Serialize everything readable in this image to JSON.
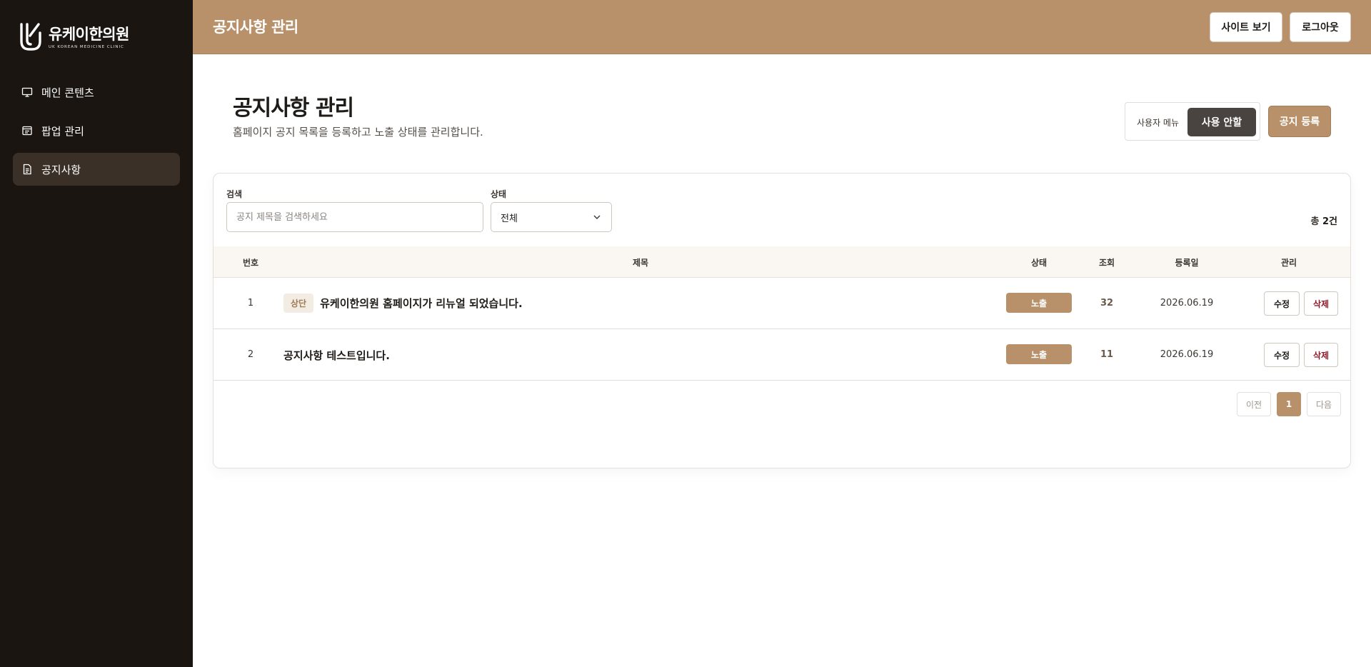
{
  "brand": {
    "name": "유케이한의원",
    "subtitle": "UK KOREAN MEDICINE CLINIC"
  },
  "sidebar": {
    "items": [
      {
        "label": "메인 콘텐츠",
        "icon": "monitor-icon",
        "active": false
      },
      {
        "label": "팝업 관리",
        "icon": "popup-window-icon",
        "active": false
      },
      {
        "label": "공지사항",
        "icon": "document-icon",
        "active": true
      }
    ]
  },
  "header": {
    "title": "공지사항 관리",
    "site_button": "사이트 보기",
    "logout_button": "로그아웃"
  },
  "page": {
    "title": "공지사항 관리",
    "description": "홈페이지 공지 목록을 등록하고 노출 상태를 관리합니다.",
    "user_menu_label": "사용자 메뉴",
    "user_guide_button": "사용 안할",
    "register_button": "공지 등록"
  },
  "filters": {
    "search_label": "검색",
    "search_placeholder": "공지 제목을 검색하세요",
    "search_value": "",
    "status_label": "상태",
    "status_value": "전체"
  },
  "total": {
    "prefix": "총 ",
    "count": "2건"
  },
  "table": {
    "headers": {
      "number": "번호",
      "title": "제목",
      "status": "상태",
      "views": "조회",
      "date": "등록일",
      "manage": "관리"
    },
    "rows": [
      {
        "number": "1",
        "pin": "상단",
        "title": "유케이한의원 홈페이지가 리뉴얼 되었습니다.",
        "status": "노출",
        "views": "32",
        "date": "2026.06.19",
        "edit": "수정",
        "delete": "삭제"
      },
      {
        "number": "2",
        "pin": "",
        "title": "공지사항 테스트입니다.",
        "status": "노출",
        "views": "11",
        "date": "2026.06.19",
        "edit": "수정",
        "delete": "삭제"
      }
    ]
  },
  "pagination": {
    "prev": "이전",
    "current": "1",
    "next": "다음"
  },
  "colors": {
    "accent": "#b8916b",
    "sidebar_bg": "#1a1511",
    "active_nav": "#3a3027",
    "delete_text": "#8d1b2a",
    "dark_button": "#4a4440"
  }
}
